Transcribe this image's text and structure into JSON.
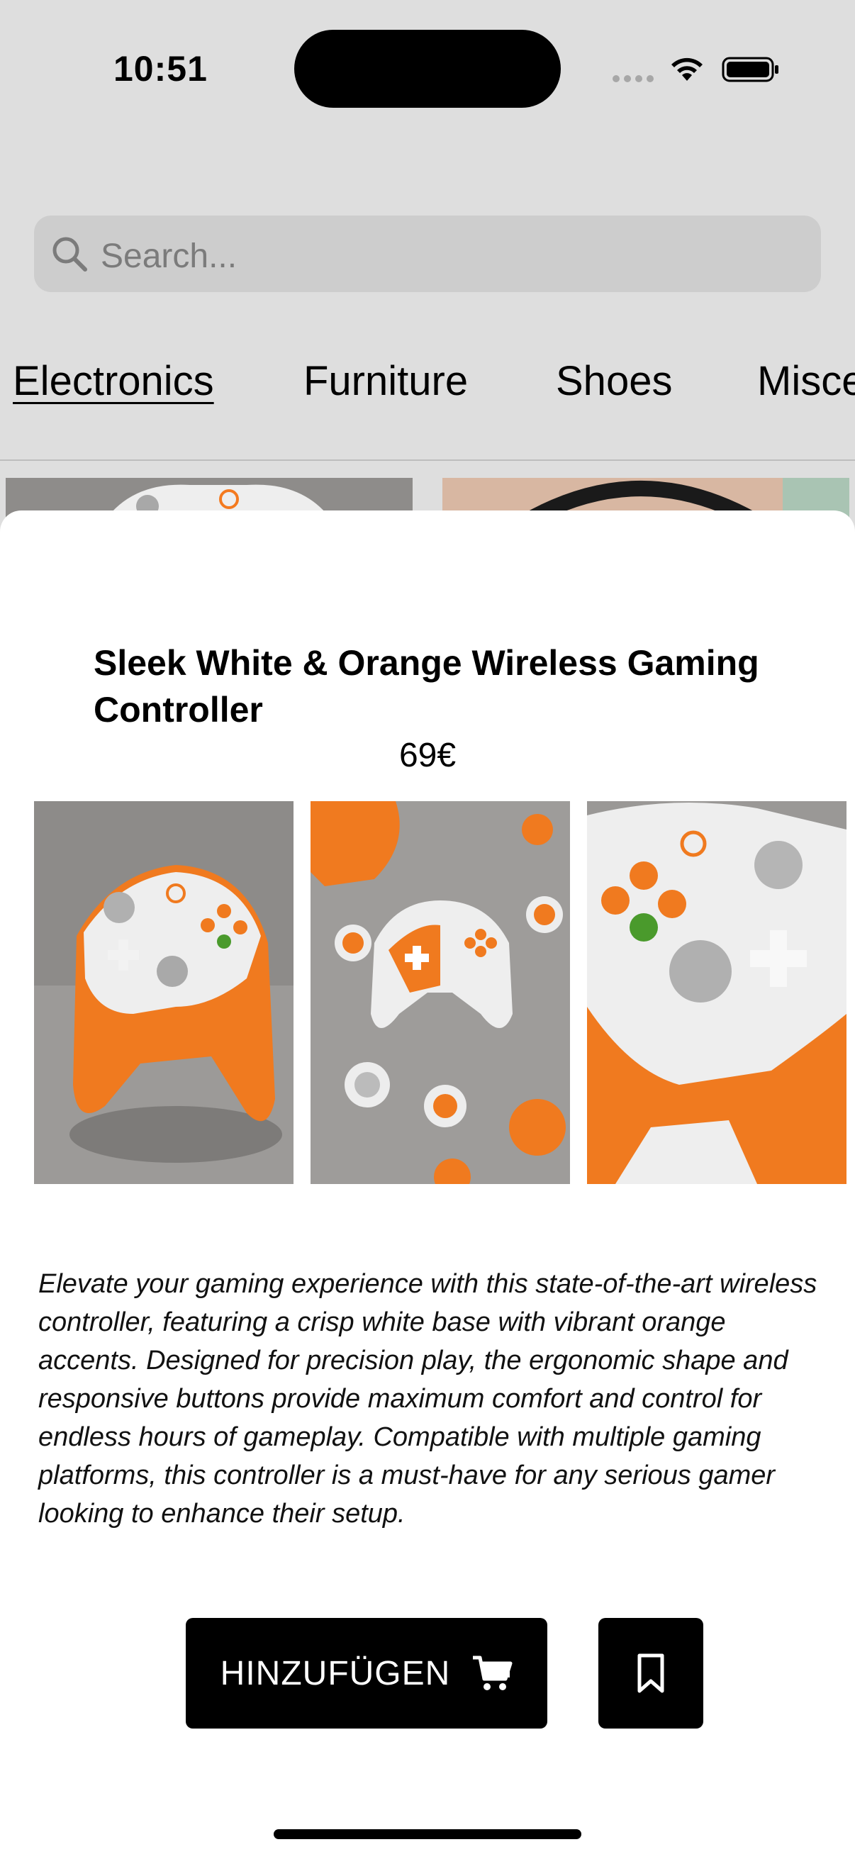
{
  "status_bar": {
    "time": "10:51"
  },
  "search": {
    "placeholder": "Search..."
  },
  "categories": [
    "Electronics",
    "Furniture",
    "Shoes",
    "Misce"
  ],
  "active_category": "Electronics",
  "product": {
    "title": "Sleek White & Orange Wireless Gaming Controller",
    "price": "69€",
    "images": [
      {
        "icon": "controller-angle-image"
      },
      {
        "icon": "controller-flatlay-image"
      },
      {
        "icon": "controller-closeup-image"
      }
    ],
    "description": "Elevate your gaming experience with this state-of-the-art wireless controller, featuring a crisp white base with vibrant orange accents. Designed for precision play, the ergonomic shape and responsive buttons provide maximum comfort and control for endless hours of gameplay. Compatible with multiple gaming platforms, this controller is a must-have for any serious gamer looking to enhance their setup."
  },
  "actions": {
    "add_to_cart_label": "HINZUFÜGEN",
    "add_to_cart_icon": "cart-icon",
    "bookmark_icon": "bookmark-icon"
  },
  "colors": {
    "accent_orange": "#f47a1f",
    "controller_white": "#eeeeee",
    "button_black": "#000000"
  }
}
